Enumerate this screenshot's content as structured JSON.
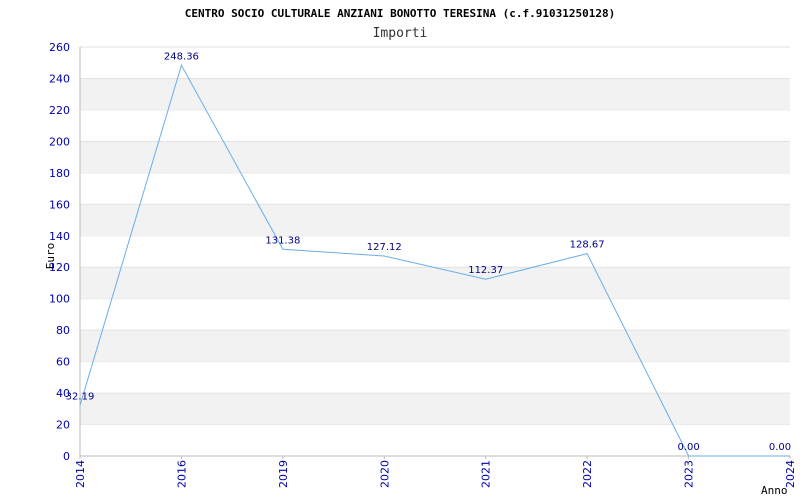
{
  "chart_data": {
    "type": "line",
    "title": "CENTRO SOCIO CULTURALE ANZIANI BONOTTO TERESINA (c.f.91031250128)",
    "subtitle": "Importi",
    "xlabel": "Anno",
    "ylabel": "Euro",
    "categories": [
      "2014",
      "2016",
      "2019",
      "2020",
      "2021",
      "2022",
      "2023",
      "2024"
    ],
    "series": [
      {
        "values": [
          32.19,
          248.36,
          131.38,
          127.12,
          112.37,
          128.67,
          0.0,
          0.0
        ],
        "labels": [
          "32.19",
          "248.36",
          "131.38",
          "127.12",
          "112.37",
          "128.67",
          "0.00",
          "0.00"
        ]
      }
    ],
    "ylim": [
      0,
      260
    ],
    "yticks": [
      "0",
      "20",
      "40",
      "60",
      "80",
      "100",
      "120",
      "140",
      "160",
      "180",
      "200",
      "220",
      "240",
      "260"
    ],
    "grid": "alternating horizontal bands",
    "colors": {
      "line": "#6aaee8",
      "band": "#f2f2f2",
      "tick_text": "#0000aa",
      "axis": "#bbbbbb"
    }
  }
}
